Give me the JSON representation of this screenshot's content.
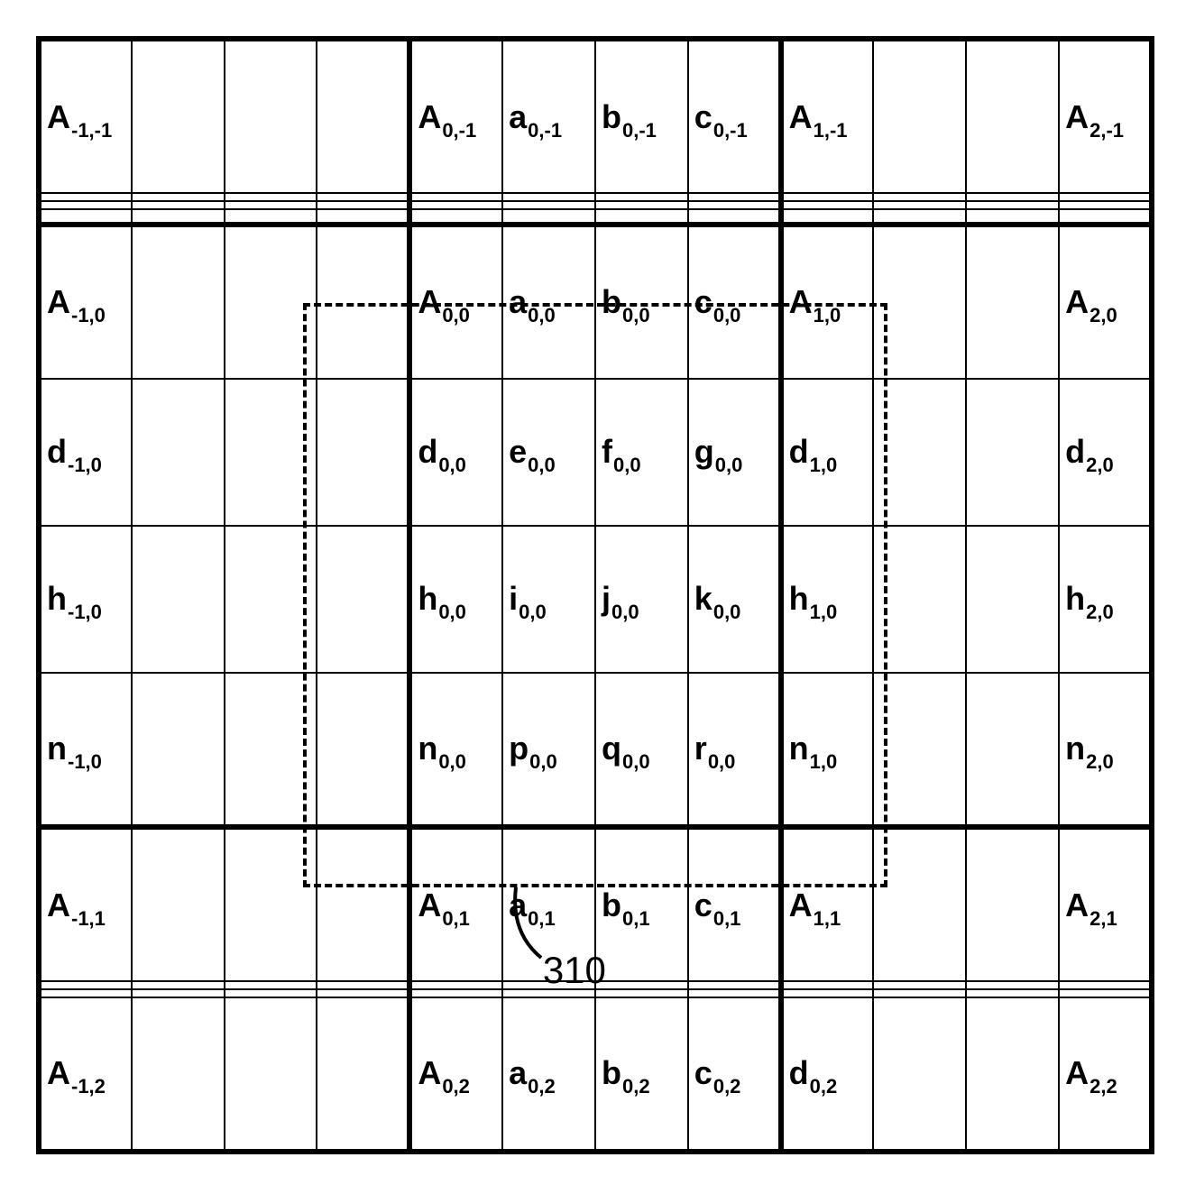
{
  "diagram": {
    "rows": 12,
    "cols": 12,
    "thick_vertical_after_cols": [
      0,
      4,
      8,
      12
    ],
    "thick_horizontal_after_rows": [
      0,
      4,
      8,
      12
    ],
    "cells": {
      "r1": {
        "c1": "A|-1,-1",
        "c5": "A|0,-1",
        "c6": "a|0,-1",
        "c7": "b|0,-1",
        "c8": "c|0,-1",
        "c9": "A|1,-1",
        "c12": "A|2,-1"
      },
      "r5": {
        "c1": "A|-1,0",
        "c5": "A|0,0",
        "c6": "a|0,0",
        "c7": "b|0,0",
        "c8": "c|0,0",
        "c9": "A|1,0",
        "c12": "A|2,0"
      },
      "r6": {
        "c1": "d|-1,0",
        "c5": "d|0,0",
        "c6": "e|0,0",
        "c7": "f|0,0",
        "c8": "g|0,0",
        "c9": "d|1,0",
        "c12": "d|2,0"
      },
      "r7": {
        "c1": "h|-1,0",
        "c5": "h|0,0",
        "c6": "i|0,0",
        "c7": "j|0,0",
        "c8": "k|0,0",
        "c9": "h|1,0",
        "c12": "h|2,0"
      },
      "r8": {
        "c1": "n|-1,0",
        "c5": "n|0,0",
        "c6": "p|0,0",
        "c7": "q|0,0",
        "c8": "r|0,0",
        "c9": "n|1,0",
        "c12": "n|2,0"
      },
      "r9": {
        "c1": "A|-1,1",
        "c5": "A|0,1",
        "c6": "a|0,1",
        "c7": "b|0,1",
        "c8": "c|0,1",
        "c9": "A|1,1",
        "c12": "A|2,1"
      },
      "r12": {
        "c1": "A|-1,2",
        "c5": "A|0,2",
        "c6": "a|0,2",
        "c7": "b|0,2",
        "c8": "c|0,2",
        "c9": "d|0,2",
        "c12": "A|2,2"
      }
    },
    "dashed_region": {
      "row_start": 4,
      "row_end": 9,
      "col_start": 4,
      "col_end": 9
    },
    "callout": {
      "label": "310",
      "points_to_row": 9,
      "points_to_col": 6
    }
  }
}
